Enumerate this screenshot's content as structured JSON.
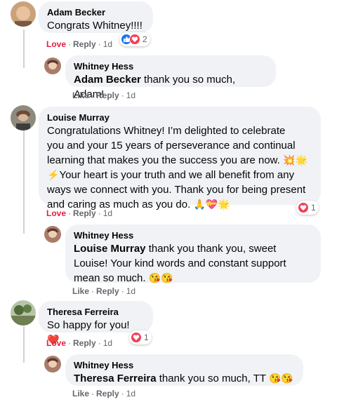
{
  "comments": [
    {
      "author": "Adam Becker",
      "text": "Congrats Whitney!!!!",
      "actions": {
        "love": "Love",
        "reply": "Reply",
        "time": "1d"
      },
      "reactions": {
        "icons": [
          "like-icon",
          "love-icon"
        ],
        "count": "2"
      },
      "reply": {
        "author": "Whitney Hess",
        "mention": "Adam Becker",
        "text": " thank you so much, Adam!",
        "actions": {
          "like": "Like",
          "reply": "Reply",
          "time": "1d"
        }
      }
    },
    {
      "author": "Louise Murray",
      "lines": [
        "Congratulations Whitney! I’m delighted to celebrate",
        "you and your 15 years of perseverance and continual",
        "learning that makes you the success you are now.",
        "Your heart is your truth and we all benefit from any",
        "ways we connect with you. Thank you for being present",
        "and caring as much as you do."
      ],
      "emoji": {
        "line3": "💥🌟",
        "line4_prefix": "⚡",
        "line6": "🙏💝🌟"
      },
      "actions": {
        "love": "Love",
        "reply": "Reply",
        "time": "1d"
      },
      "reactions": {
        "icons": [
          "love-icon"
        ],
        "count": "1"
      },
      "reply": {
        "author": "Whitney Hess",
        "mention": "Louise Murray",
        "text_line1": " thank you thank you, sweet",
        "text_line2": "Louise! Your kind words and constant support",
        "text_line3": "mean so much.",
        "emoji": "😘😘",
        "actions": {
          "like": "Like",
          "reply": "Reply",
          "time": "1d"
        }
      }
    },
    {
      "author": "Theresa Ferreira",
      "text": "So happy for you!",
      "emoji": "❤️",
      "actions": {
        "love": "Love",
        "reply": "Reply",
        "time": "1d"
      },
      "reactions": {
        "icons": [
          "love-icon"
        ],
        "count": "1"
      },
      "reply": {
        "author": "Whitney Hess",
        "mention": "Theresa Ferreira",
        "text": " thank you so much, TT",
        "emoji": "😘😘",
        "actions": {
          "like": "Like",
          "reply": "Reply",
          "time": "1d"
        }
      }
    }
  ],
  "colors": {
    "bubble": "#f0f2f5",
    "love": "#e41e3f",
    "like_blue": "#1877f2",
    "meta": "#65676b"
  }
}
